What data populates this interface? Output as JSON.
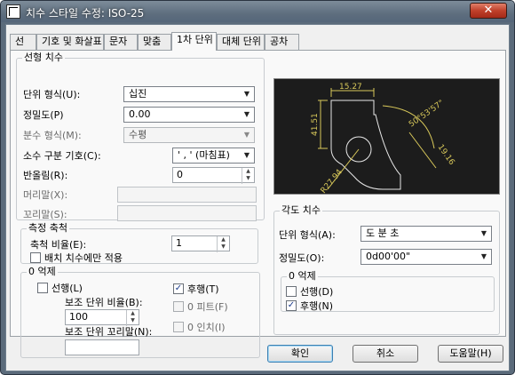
{
  "window": {
    "title": "치수 스타일 수정: ISO-25",
    "close_label": "✕"
  },
  "tabs": [
    {
      "label": "선"
    },
    {
      "label": "기호 및 화살표"
    },
    {
      "label": "문자"
    },
    {
      "label": "맞춤"
    },
    {
      "label": "1차 단위"
    },
    {
      "label": "대체 단위"
    },
    {
      "label": "공차"
    }
  ],
  "linear": {
    "title": "선형 치수",
    "unit_format": {
      "label": "단위 형식(U):",
      "value": "십진"
    },
    "precision": {
      "label": "정밀도(P)",
      "value": "0.00"
    },
    "fraction_format": {
      "label": "분수 형식(M):",
      "value": "수평"
    },
    "decimal_separator": {
      "label": "소수 구분 기호(C):",
      "value": "' , ' (마침표)"
    },
    "round_off": {
      "label": "반올림(R):",
      "value": "0"
    },
    "prefix": {
      "label": "머리말(X):",
      "value": ""
    },
    "suffix": {
      "label": "꼬리말(S):",
      "value": ""
    }
  },
  "scale": {
    "title": "측정 축척",
    "factor_label": "축척 비율(E):",
    "factor_value": "1",
    "layout_only_label": "배치 치수에만 적용",
    "layout_only_checked": false
  },
  "zero_suppression": {
    "title": "0 억제",
    "leading": {
      "label": "선행(L)",
      "checked": false
    },
    "trailing": {
      "label": "후행(T)",
      "checked": true
    },
    "sub_factor_label": "보조 단위 비율(B):",
    "sub_factor_value": "100",
    "feet": {
      "label": "0 피트(F)",
      "checked": false
    },
    "inches": {
      "label": "0 인치(I)",
      "checked": false
    },
    "sub_suffix_label": "보조 단위 꼬리말(N):",
    "sub_suffix_value": ""
  },
  "angular": {
    "title": "각도 치수",
    "unit_format": {
      "label": "단위 형식(A):",
      "value": "도 분 초"
    },
    "precision": {
      "label": "정밀도(O):",
      "value": "0d00'00\""
    },
    "zero_suppression_title": "0 억제",
    "leading": {
      "label": "선행(D)",
      "checked": false
    },
    "trailing": {
      "label": "후행(N)",
      "checked": true
    }
  },
  "preview": {
    "dim_top": "15.27",
    "dim_left": "41.51",
    "dim_angle": "50°53'57\"",
    "dim_right": "19.16",
    "dim_radius": "R27.94"
  },
  "buttons": {
    "ok": "확인",
    "cancel": "취소",
    "help": "도움말(H)"
  },
  "colors": {
    "preview_bg": "#1c1c1c",
    "preview_lines": "#e8e8e8",
    "preview_dims": "#d8c85a"
  }
}
